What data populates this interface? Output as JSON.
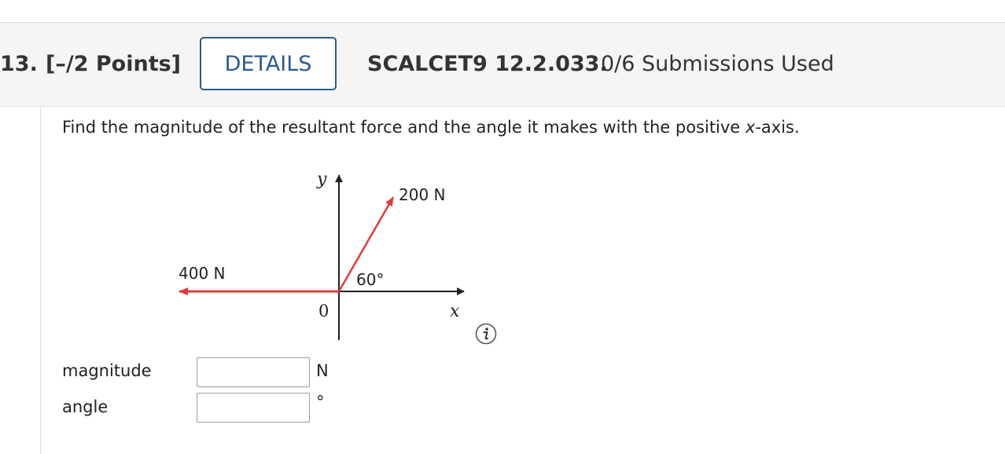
{
  "question": {
    "number": "13.",
    "points": "[–/2 Points]",
    "details_label": "DETAILS",
    "code": "SCALCET9 12.2.033.",
    "submissions": "0/6 Submissions Used",
    "prompt_before": "Find the magnitude of the resultant force and the angle it makes with the positive ",
    "prompt_var": "x",
    "prompt_after": "-axis."
  },
  "figure": {
    "y_axis_label": "y",
    "x_axis_label": "x",
    "origin_label": "0",
    "force_1_label": "200 N",
    "force_2_label": "400 N",
    "angle_label": "60°",
    "force_color": "#e03c3c",
    "axis_color": "#222222"
  },
  "answers": {
    "magnitude_label": "magnitude",
    "magnitude_value": "",
    "magnitude_unit": "N",
    "angle_label": "angle",
    "angle_value": "",
    "angle_unit": "°"
  },
  "icons": {
    "info": "info-icon"
  }
}
